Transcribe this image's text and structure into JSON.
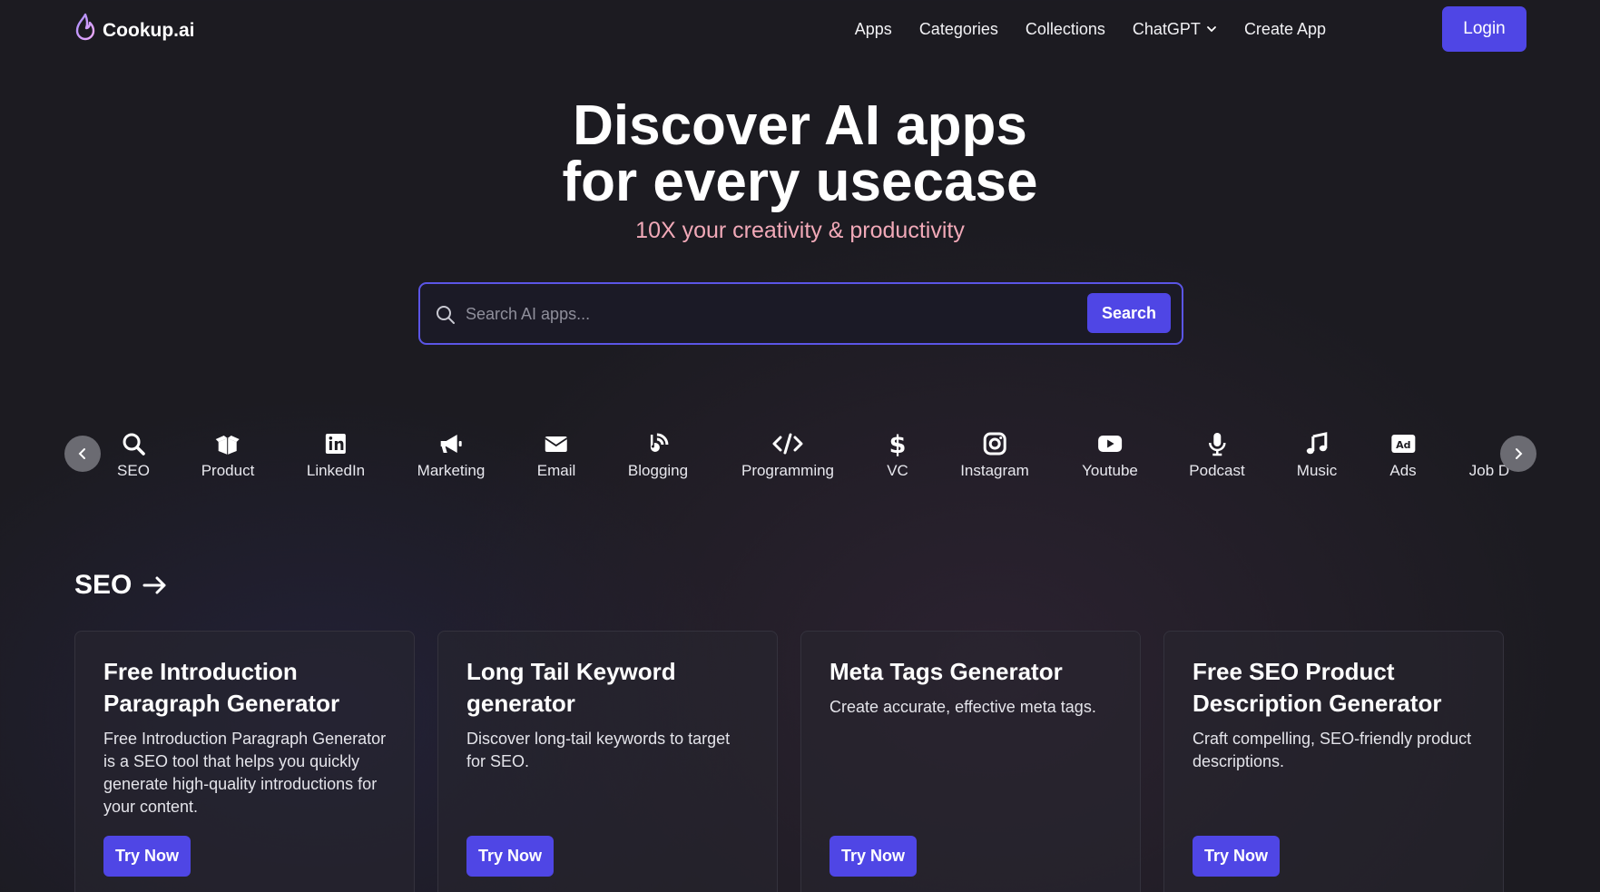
{
  "brand": {
    "name": "Cookup.ai",
    "logo_icon": "flame-logo-icon"
  },
  "nav": {
    "links": [
      {
        "label": "Apps"
      },
      {
        "label": "Categories"
      },
      {
        "label": "Collections"
      },
      {
        "label": "ChatGPT",
        "has_dropdown": true
      },
      {
        "label": "Create App"
      }
    ],
    "login_label": "Login"
  },
  "hero": {
    "title_line1": "Discover AI apps",
    "title_line2": "for every usecase",
    "subtitle": "10X your creativity & productivity"
  },
  "search": {
    "placeholder": "Search AI apps...",
    "value": "",
    "button_label": "Search"
  },
  "categories": [
    {
      "label": "SEO",
      "icon": "search-icon"
    },
    {
      "label": "Product",
      "icon": "box-open-icon"
    },
    {
      "label": "LinkedIn",
      "icon": "linkedin-icon"
    },
    {
      "label": "Marketing",
      "icon": "megaphone-icon"
    },
    {
      "label": "Email",
      "icon": "envelope-icon"
    },
    {
      "label": "Blogging",
      "icon": "blog-icon"
    },
    {
      "label": "Programming",
      "icon": "code-icon"
    },
    {
      "label": "VC",
      "icon": "dollar-icon"
    },
    {
      "label": "Instagram",
      "icon": "instagram-icon"
    },
    {
      "label": "Youtube",
      "icon": "youtube-icon"
    },
    {
      "label": "Podcast",
      "icon": "microphone-icon"
    },
    {
      "label": "Music",
      "icon": "music-note-icon"
    },
    {
      "label": "Ads",
      "icon": "ad-icon"
    },
    {
      "label": "Job D",
      "icon": ""
    }
  ],
  "section": {
    "title": "SEO",
    "cards": [
      {
        "title": "Free Introduction Paragraph Generator",
        "description": "Free Introduction Paragraph Generator is a SEO tool that helps you quickly generate high-quality introductions for your content.",
        "button_label": "Try Now"
      },
      {
        "title": "Long Tail Keyword generator",
        "description": "Discover long-tail keywords to target for SEO.",
        "button_label": "Try Now"
      },
      {
        "title": "Meta Tags Generator",
        "description": "Create accurate, effective meta tags.",
        "button_label": "Try Now"
      },
      {
        "title": "Free SEO Product Description Generator",
        "description": "Craft compelling, SEO-friendly product descriptions.",
        "button_label": "Try Now"
      }
    ]
  },
  "colors": {
    "accent": "#4f46e5",
    "background": "#1c1b21",
    "subtitle": "#f1a9b8"
  }
}
